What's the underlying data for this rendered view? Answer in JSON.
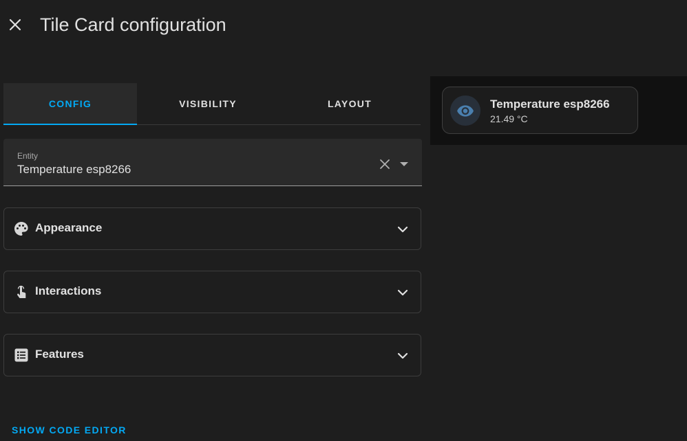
{
  "dialog": {
    "title": "Tile Card configuration"
  },
  "tabs": [
    {
      "label": "CONFIG",
      "active": true
    },
    {
      "label": "VISIBILITY",
      "active": false
    },
    {
      "label": "LAYOUT",
      "active": false
    }
  ],
  "entity": {
    "label": "Entity",
    "value": "Temperature esp8266"
  },
  "panels": [
    {
      "label": "Appearance",
      "icon": "palette-icon"
    },
    {
      "label": "Interactions",
      "icon": "gesture-tap-icon"
    },
    {
      "label": "Features",
      "icon": "list-box-icon"
    }
  ],
  "code_editor_label": "SHOW CODE EDITOR",
  "preview": {
    "tile": {
      "name": "Temperature esp8266",
      "state": "21.49 °C",
      "icon": "eye-icon"
    }
  },
  "colors": {
    "background": "#1e1e1e",
    "accent": "#03a9f4",
    "tile_icon": "#4a7fae",
    "preview_background": "#111111"
  }
}
